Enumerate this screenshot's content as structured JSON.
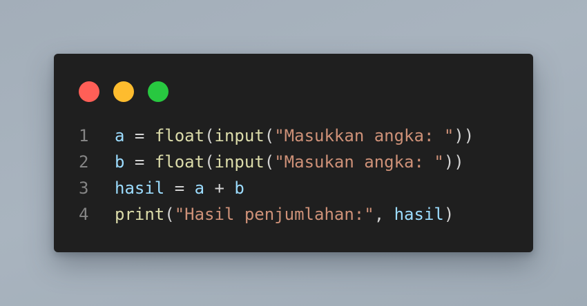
{
  "window": {
    "dots": [
      {
        "name": "close",
        "color": "#ff5f57"
      },
      {
        "name": "minimize",
        "color": "#febc2e"
      },
      {
        "name": "maximize",
        "color": "#28c840"
      }
    ]
  },
  "code": {
    "lines": [
      {
        "n": "1",
        "tokens": [
          {
            "t": "a",
            "k": "var"
          },
          {
            "t": " = ",
            "k": "op"
          },
          {
            "t": "float",
            "k": "fn"
          },
          {
            "t": "(",
            "k": "op"
          },
          {
            "t": "input",
            "k": "fn"
          },
          {
            "t": "(",
            "k": "op"
          },
          {
            "t": "\"Masukkan angka: \"",
            "k": "str"
          },
          {
            "t": "))",
            "k": "op"
          }
        ]
      },
      {
        "n": "2",
        "tokens": [
          {
            "t": "b",
            "k": "var"
          },
          {
            "t": " = ",
            "k": "op"
          },
          {
            "t": "float",
            "k": "fn"
          },
          {
            "t": "(",
            "k": "op"
          },
          {
            "t": "input",
            "k": "fn"
          },
          {
            "t": "(",
            "k": "op"
          },
          {
            "t": "\"Masukan angka: \"",
            "k": "str"
          },
          {
            "t": "))",
            "k": "op"
          }
        ]
      },
      {
        "n": "3",
        "tokens": [
          {
            "t": "hasil",
            "k": "var"
          },
          {
            "t": " = ",
            "k": "op"
          },
          {
            "t": "a",
            "k": "var"
          },
          {
            "t": " + ",
            "k": "op"
          },
          {
            "t": "b",
            "k": "var"
          }
        ]
      },
      {
        "n": "4",
        "tokens": [
          {
            "t": "print",
            "k": "fn"
          },
          {
            "t": "(",
            "k": "op"
          },
          {
            "t": "\"Hasil penjumlahan:\"",
            "k": "str"
          },
          {
            "t": ", ",
            "k": "op"
          },
          {
            "t": "hasil",
            "k": "var"
          },
          {
            "t": ")",
            "k": "op"
          }
        ]
      }
    ]
  }
}
